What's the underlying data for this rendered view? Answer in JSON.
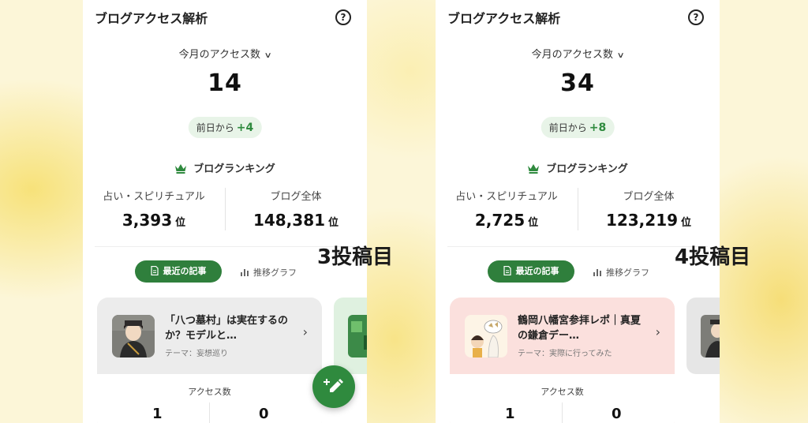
{
  "left": {
    "header_title": "ブログアクセス解析",
    "period_label": "今月のアクセス数",
    "access_count": "14",
    "diff_prefix": "前日から",
    "diff_value": "+4",
    "ranking_title": "ブログランキング",
    "rank_category_label": "占い・スピリチュアル",
    "rank_category_value": "3,393",
    "rank_overall_label": "ブログ全体",
    "rank_overall_value": "148,381",
    "rank_unit": "位",
    "tab_recent": "最近の記事",
    "tab_graph": "推移グラフ",
    "article_title": "「八つ墓村」は実在するのか？モデルと…",
    "article_theme": "テーマ：妄想巡り",
    "access_label": "アクセス数",
    "access_a": "1",
    "access_b": "0"
  },
  "right": {
    "header_title": "ブログアクセス解析",
    "period_label": "今月のアクセス数",
    "access_count": "34",
    "diff_prefix": "前日から",
    "diff_value": "+8",
    "ranking_title": "ブログランキング",
    "rank_category_label": "占い・スピリチュアル",
    "rank_category_value": "2,725",
    "rank_overall_label": "ブログ全体",
    "rank_overall_value": "123,219",
    "rank_unit": "位",
    "tab_recent": "最近の記事",
    "tab_graph": "推移グラフ",
    "article_title": "鶴岡八幡宮参拝レポ｜真夏の鎌倉デー…",
    "article_theme": "テーマ：実際に行ってみた",
    "access_label": "アクセス数",
    "access_a": "1",
    "access_b": "0"
  },
  "annotations": {
    "left_label": "3投稿目",
    "right_label": "4投稿目"
  },
  "colors": {
    "accent_green": "#2f7f3c",
    "diff_bg": "#e8f4e8",
    "card_grey": "#ececec",
    "card_pink": "#fbe0dd"
  },
  "icons": [
    "help-icon",
    "chevron-down-icon",
    "crown-icon",
    "document-icon",
    "bar-chart-icon",
    "chevron-right-icon",
    "pencil-plus-icon"
  ]
}
